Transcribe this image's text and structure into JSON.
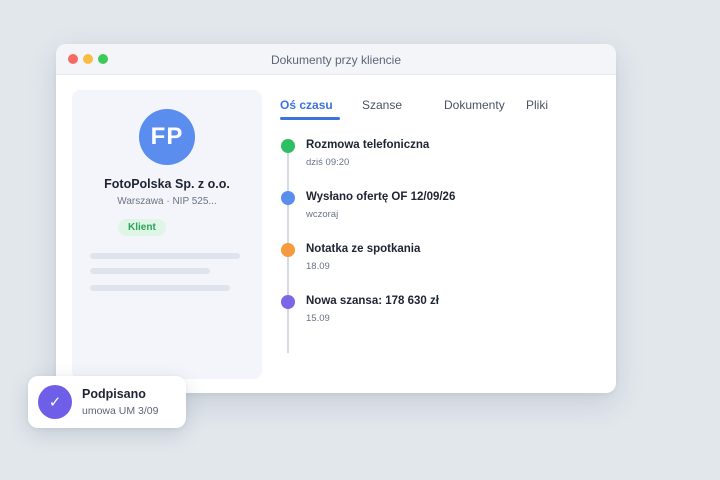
{
  "window": {
    "title": "Dokumenty przy kliencie"
  },
  "client": {
    "initials": "FP",
    "name": "FotoPolska Sp. z o.o.",
    "subtitle": "Warszawa · NIP 525...",
    "badge": "Klient",
    "avatar_color": "#5b8def",
    "badge_color": "#2ba35a"
  },
  "tabs": [
    {
      "label": "Oś czasu",
      "active": true
    },
    {
      "label": "Szanse",
      "active": false
    },
    {
      "label": "Dokumenty",
      "active": false
    },
    {
      "label": "Pliki",
      "active": false
    }
  ],
  "timeline": [
    {
      "title": "Rozmowa telefoniczna",
      "time": "dziś 09:20",
      "color": "#2fbf63"
    },
    {
      "title": "Wysłano ofertę OF 12/09/26",
      "time": "wczoraj",
      "color": "#5b8def"
    },
    {
      "title": "Notatka ze spotkania",
      "time": "18.09",
      "color": "#f59b3d"
    },
    {
      "title": "Nowa szansa: 178 630 zł",
      "time": "15.09",
      "color": "#7b66e8"
    }
  ],
  "toast": {
    "title": "Podpisano",
    "subtitle": "umowa UM 3/09",
    "icon": "check-icon",
    "icon_glyph": "✓",
    "color": "#6f5ee8"
  },
  "accent_color": "#3d73e0"
}
